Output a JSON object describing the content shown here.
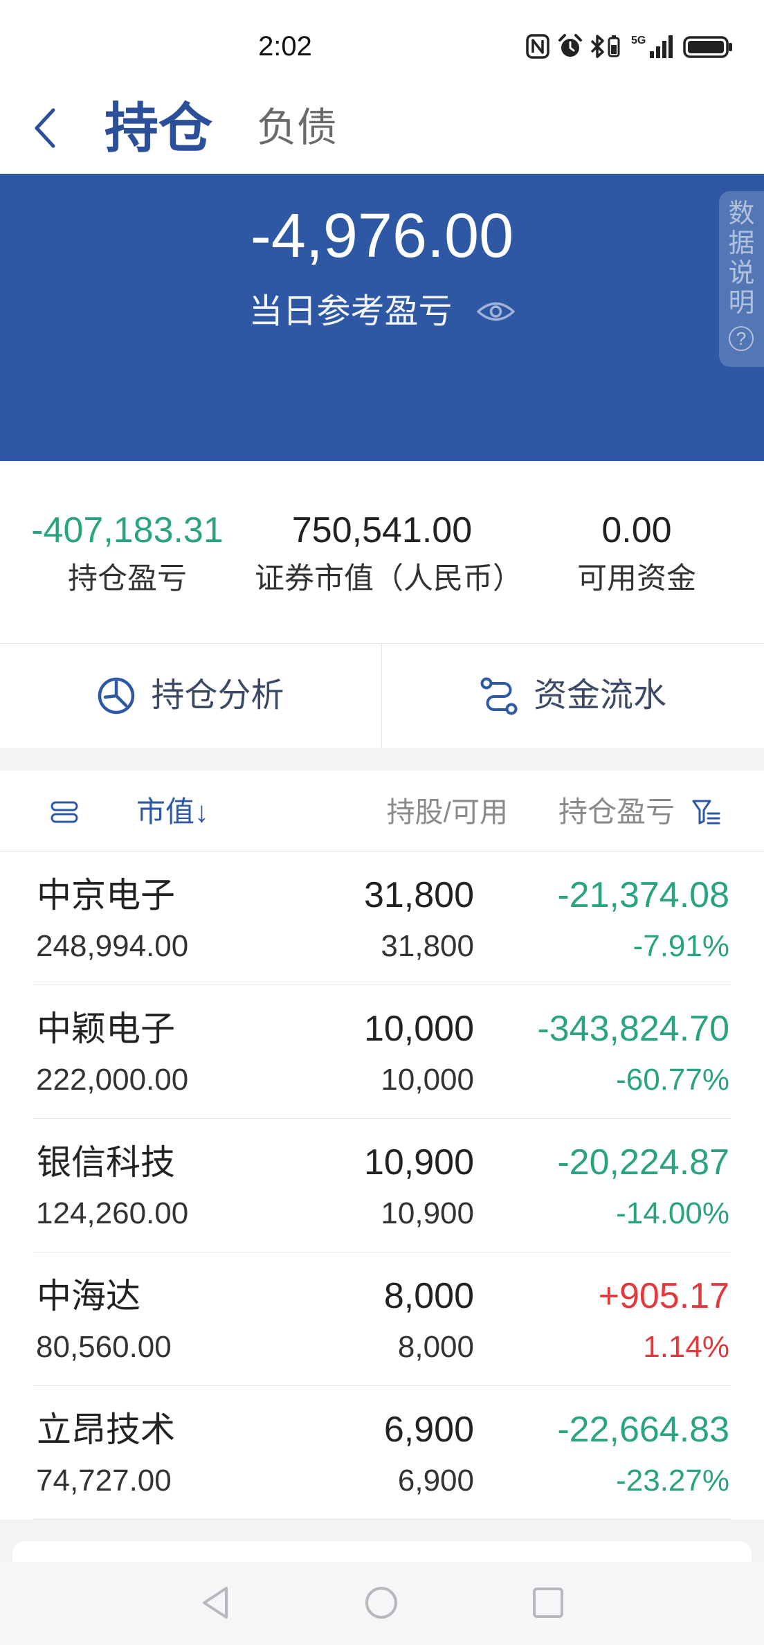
{
  "status_bar": {
    "time": "2:02",
    "network": "5G",
    "icons": [
      "nfc-icon",
      "alarm-icon",
      "bluetooth-icon",
      "signal-icon",
      "battery-icon"
    ]
  },
  "header": {
    "back_icon": "chevron-left-icon",
    "tabs": [
      {
        "label": "持仓",
        "active": true
      },
      {
        "label": "负债",
        "active": false
      }
    ]
  },
  "summary": {
    "day_pnl": "-4,976.00",
    "day_pnl_label": "当日参考盈亏",
    "visibility_icon": "eye-icon",
    "side_tab": {
      "label": "数据说明",
      "help_glyph": "?"
    }
  },
  "stats": [
    {
      "value": "-407,183.31",
      "label": "持仓盈亏"
    },
    {
      "value": "750,541.00",
      "label": "证券市值（人民币）"
    },
    {
      "value": "0.00",
      "label": "可用资金"
    }
  ],
  "actions": [
    {
      "label": "持仓分析",
      "icon": "pie-chart-icon"
    },
    {
      "label": "资金流水",
      "icon": "flow-icon"
    }
  ],
  "table": {
    "columns": {
      "sort_label": "市值",
      "sort_arrow": "↓",
      "shares": "持股/可用",
      "pnl": "持仓盈亏"
    },
    "rows": [
      {
        "name": "中京电子",
        "market_value": "248,994.00",
        "shares": "31,800",
        "available": "31,800",
        "pnl": "-21,374.08",
        "pnl_pct": "-7.91%"
      },
      {
        "name": "中颖电子",
        "market_value": "222,000.00",
        "shares": "10,000",
        "available": "10,000",
        "pnl": "-343,824.70",
        "pnl_pct": "-60.77%"
      },
      {
        "name": "银信科技",
        "market_value": "124,260.00",
        "shares": "10,900",
        "available": "10,900",
        "pnl": "-20,224.87",
        "pnl_pct": "-14.00%"
      },
      {
        "name": "中海达",
        "market_value": "80,560.00",
        "shares": "8,000",
        "available": "8,000",
        "pnl": "+905.17",
        "pnl_pct": "1.14%"
      },
      {
        "name": "立昂技术",
        "market_value": "74,727.00",
        "shares": "6,900",
        "available": "6,900",
        "pnl": "-22,664.83",
        "pnl_pct": "-23.27%"
      }
    ]
  },
  "nav_bar": {
    "icons": [
      "back-triangle-icon",
      "home-circle-icon",
      "recents-square-icon"
    ]
  },
  "colors": {
    "banner": "#2e58a4",
    "accent": "#2d58a5",
    "up": "#e4393c",
    "down": "#2aa382"
  }
}
